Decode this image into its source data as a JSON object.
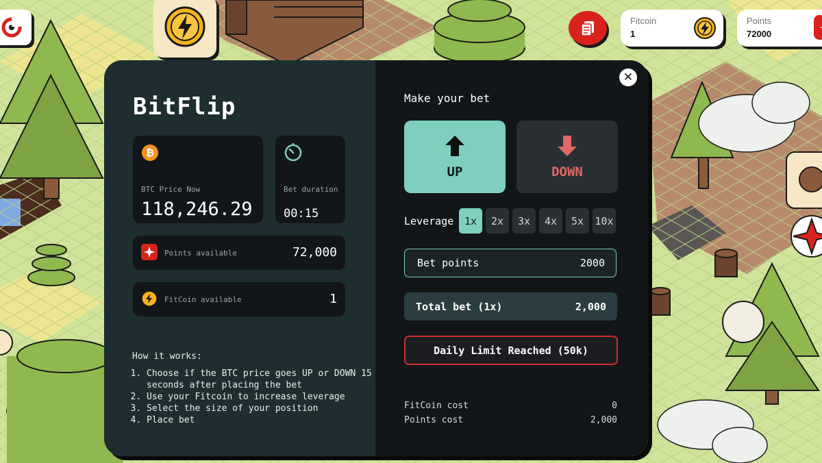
{
  "colors": {
    "accent": "#7fcfc0",
    "danger": "#c9302c",
    "down_text": "#e06866",
    "panel_left": "#1e2e30",
    "panel_right": "#121619",
    "bitcoin": "#f7931a",
    "points_red": "#d8231d"
  },
  "hud": {
    "fitcoin": {
      "label": "Fitcoin",
      "value": "1",
      "icon": "fitcoin-icon"
    },
    "points": {
      "label": "Points",
      "value": "72000",
      "icon": "points-icon"
    },
    "history_icon": "history-icon",
    "coin_tile_icon": "lightning-coin-icon"
  },
  "modal": {
    "title": "BitFlip",
    "btc": {
      "label": "BTC Price Now",
      "value": "118,246.29",
      "icon": "bitcoin-icon"
    },
    "duration": {
      "label": "Bet duration",
      "value": "00:15",
      "icon": "timer-icon"
    },
    "points_available": {
      "label": "Points available",
      "value": "72,000",
      "icon": "points-icon"
    },
    "fitcoin_available": {
      "label": "FitCoin available",
      "value": "1",
      "icon": "fitcoin-icon"
    },
    "how": {
      "heading": "How it works:",
      "steps": [
        "Choose if the BTC price goes UP or DOWN 15 seconds after placing the bet",
        "Use your Fitcoin to increase leverage",
        "Select the size of your position",
        "Place bet"
      ]
    },
    "bet": {
      "heading": "Make your bet",
      "up_label": "UP",
      "down_label": "DOWN",
      "selected": "UP",
      "leverage_label": "Leverage",
      "leverage_options": [
        "1x",
        "2x",
        "3x",
        "4x",
        "5x",
        "10x"
      ],
      "leverage_selected": "1x",
      "bet_points_label": "Bet points",
      "bet_points_value": "2000",
      "total_label": "Total bet (1x)",
      "total_value": "2,000",
      "limit_button": "Daily Limit Reached (50k)",
      "fitcoin_cost_label": "FitCoin cost",
      "fitcoin_cost_value": "0",
      "points_cost_label": "Points cost",
      "points_cost_value": "2,000"
    },
    "close_icon": "close-icon"
  }
}
